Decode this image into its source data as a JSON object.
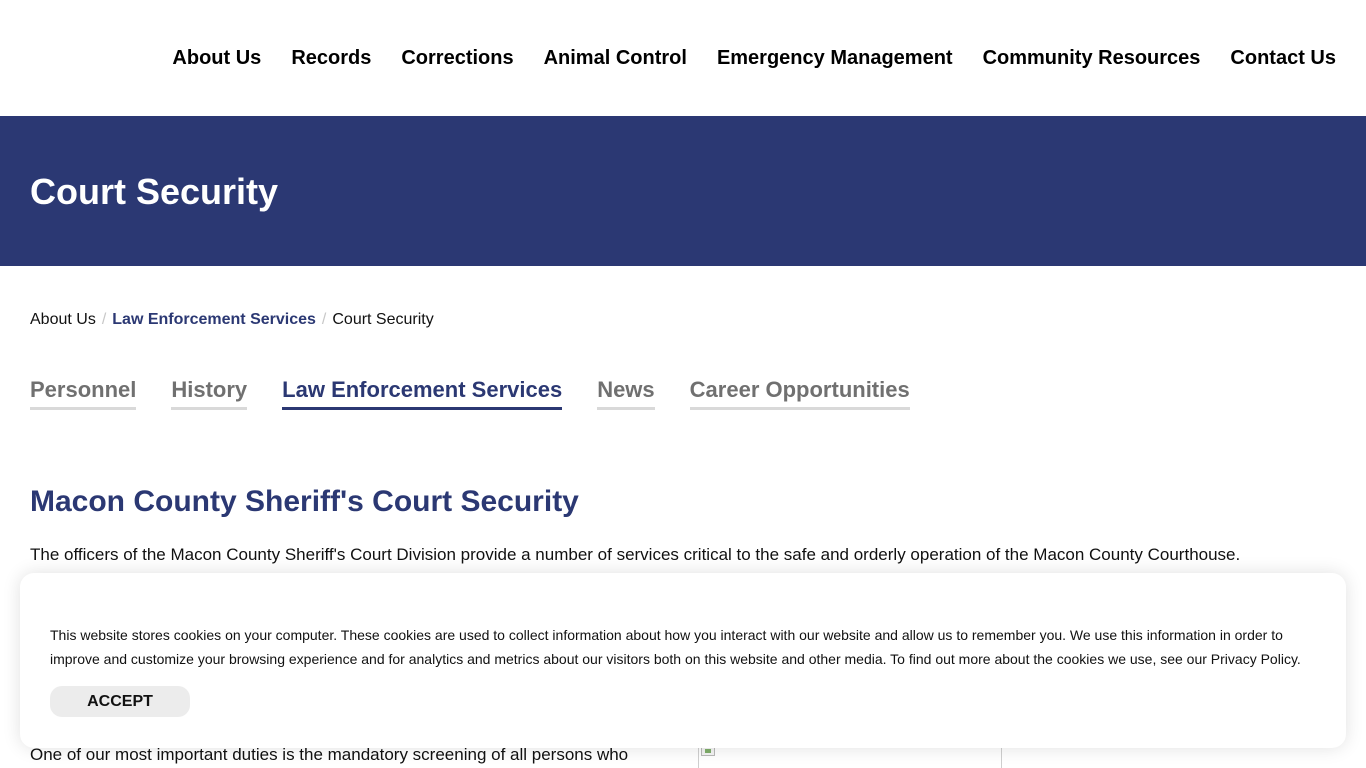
{
  "header": {
    "nav": [
      {
        "label": "About Us"
      },
      {
        "label": "Records"
      },
      {
        "label": "Corrections"
      },
      {
        "label": "Animal Control"
      },
      {
        "label": "Emergency Management"
      },
      {
        "label": "Community Resources"
      },
      {
        "label": "Contact Us"
      }
    ]
  },
  "banner": {
    "title": "Court Security",
    "background_color": "#2b3873"
  },
  "breadcrumb": {
    "items": [
      "About Us",
      "Law Enforcement Services",
      "Court Security"
    ],
    "separator": "/"
  },
  "subnav": {
    "tabs": [
      {
        "label": "Personnel",
        "active": false
      },
      {
        "label": "History",
        "active": false
      },
      {
        "label": "Law Enforcement Services",
        "active": true
      },
      {
        "label": "News",
        "active": false
      },
      {
        "label": "Career Opportunities",
        "active": false
      }
    ]
  },
  "content": {
    "heading": "Macon County Sheriff's Court Security",
    "intro": "The officers of the Macon County Sheriff's Court Division provide a number of services critical to the safe and orderly operation of the Macon County Courthouse.",
    "body": "One of our most important duties is the mandatory screening of all persons who"
  },
  "cookie_banner": {
    "text": "This website stores cookies on your computer. These cookies are used to collect information about how you interact with our website and allow us to remember you. We use this information in order to improve and customize your browsing experience and for analytics and metrics about our visitors both on this website and other media. To find out more about the cookies we use, see our Privacy Policy.",
    "accept_label": "ACCEPT"
  },
  "colors": {
    "accent": "#2b3873",
    "tab_inactive": "#707070"
  }
}
